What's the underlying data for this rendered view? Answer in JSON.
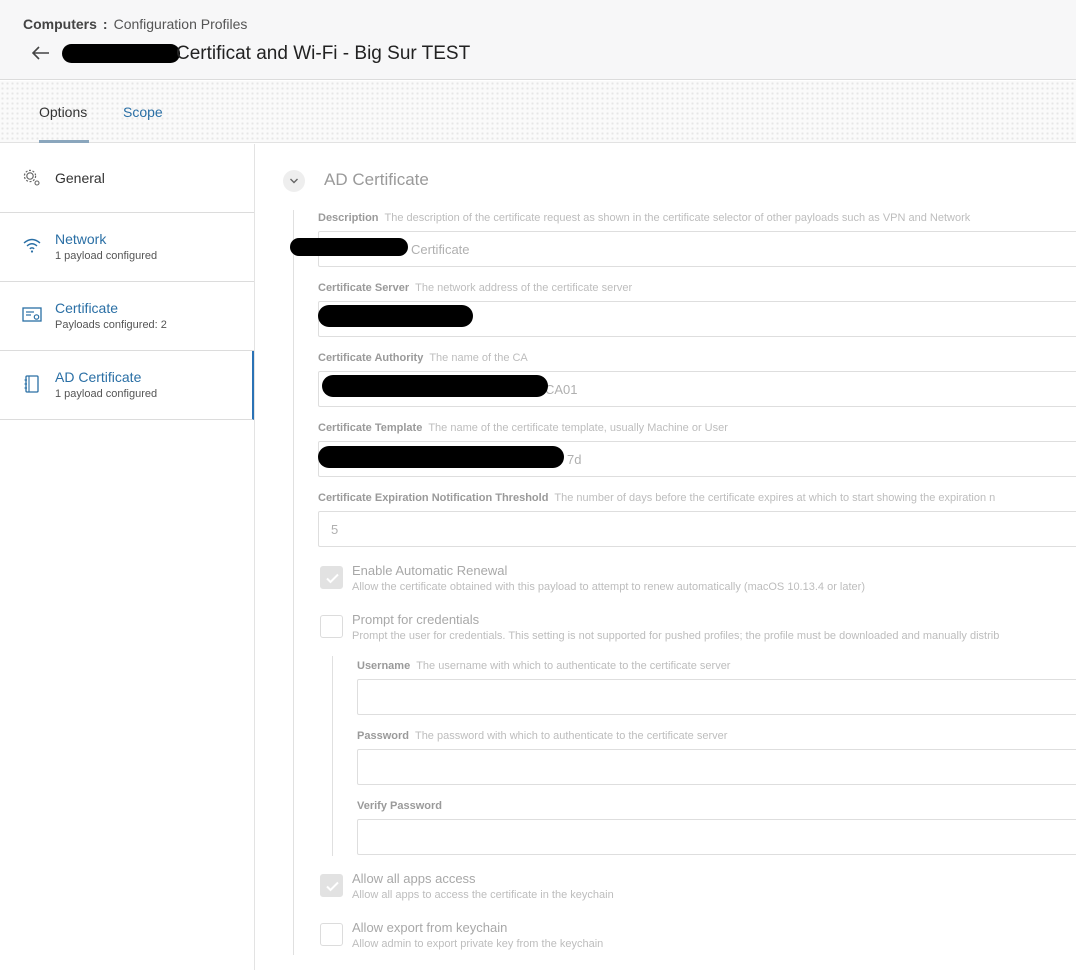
{
  "header": {
    "breadcrumb_root": "Computers",
    "breadcrumb_sep": ":",
    "breadcrumb_current": "Configuration Profiles",
    "title": "Certificat and Wi-Fi - Big Sur TEST"
  },
  "tabs": [
    {
      "label": "Options"
    },
    {
      "label": "Scope"
    }
  ],
  "sidebar": {
    "items": [
      {
        "label": "General",
        "sub": ""
      },
      {
        "label": "Network",
        "sub": "1 payload configured"
      },
      {
        "label": "Certificate",
        "sub": "Payloads configured: 2"
      },
      {
        "label": "AD Certificate",
        "sub": "1 payload configured"
      }
    ]
  },
  "section": {
    "title": "AD Certificate"
  },
  "fields": {
    "description": {
      "label": "Description",
      "help": "The description of the certificate request as shown in the certificate selector of other payloads such as VPN and Network",
      "value": "Certificate"
    },
    "server": {
      "label": "Certificate Server",
      "help": "The network address of the certificate server",
      "value": ""
    },
    "authority": {
      "label": "Certificate Authority",
      "help": "The name of the CA",
      "value": "CA01"
    },
    "template": {
      "label": "Certificate Template",
      "help": "The name of the certificate template, usually Machine or User",
      "value": "7d"
    },
    "threshold": {
      "label": "Certificate Expiration Notification Threshold",
      "help": "The number of days before the certificate expires at which to start showing the expiration n",
      "value": "5"
    },
    "username": {
      "label": "Username",
      "help": "The username with which to authenticate to the certificate server",
      "value": ""
    },
    "password": {
      "label": "Password",
      "help": "The password with which to authenticate to the certificate server",
      "value": ""
    },
    "verify": {
      "label": "Verify Password",
      "help": "",
      "value": ""
    }
  },
  "checkboxes": {
    "renewal": {
      "title": "Enable Automatic Renewal",
      "desc": "Allow the certificate obtained with this payload to attempt to renew automatically (macOS 10.13.4 or later)",
      "checked": true
    },
    "prompt": {
      "title": "Prompt for credentials",
      "desc": "Prompt the user for credentials. This setting is not supported for pushed profiles; the profile must be downloaded and manually distrib",
      "checked": false
    },
    "allapps": {
      "title": "Allow all apps access",
      "desc": "Allow all apps to access the certificate in the keychain",
      "checked": true
    },
    "export": {
      "title": "Allow export from keychain",
      "desc": "Allow admin to export private key from the keychain",
      "checked": false
    }
  },
  "colors": {
    "accent": "#2a72b5",
    "link": "#2a6fa5"
  }
}
